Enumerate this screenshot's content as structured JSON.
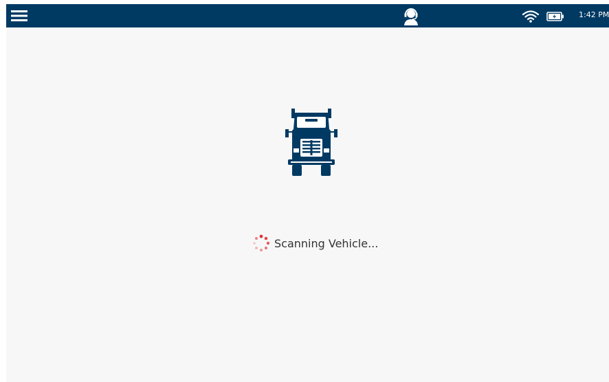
{
  "colors": {
    "topbar": "#003a63",
    "background": "#f7f7f7",
    "icon": "#003a63",
    "spinner": "#e0323c",
    "text": "#333333"
  },
  "topbar": {
    "menu_icon": "hamburger-menu-icon",
    "support_icon": "headset-support-icon",
    "wifi_icon": "wifi-icon",
    "battery_icon": "battery-charging-icon",
    "time": "1:42 PM"
  },
  "main": {
    "illustration_icon": "semi-truck-front-icon",
    "loading_icon": "loading-spinner-icon",
    "status_text": "Scanning Vehicle..."
  }
}
